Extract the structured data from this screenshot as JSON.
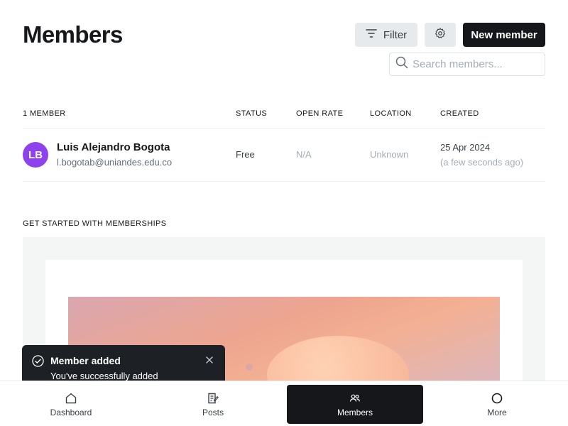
{
  "header": {
    "title": "Members",
    "filter_label": "Filter",
    "new_member_label": "New member"
  },
  "search": {
    "placeholder": "Search members..."
  },
  "table": {
    "columns": [
      "1 MEMBER",
      "STATUS",
      "OPEN RATE",
      "LOCATION",
      "CREATED"
    ],
    "rows": [
      {
        "initials": "LB",
        "name": "Luis Alejandro Bogota",
        "email": "l.bogotab@uniandes.edu.co",
        "status": "Free",
        "open_rate": "N/A",
        "location": "Unknown",
        "created_date": "25 Apr 2024",
        "created_relative": "(a few seconds ago)"
      }
    ]
  },
  "memberships": {
    "label": "GET STARTED WITH MEMBERSHIPS"
  },
  "toast": {
    "title": "Member added",
    "message": "You've successfully added"
  },
  "tabbar": {
    "items": [
      {
        "label": "Dashboard",
        "icon": "home-icon"
      },
      {
        "label": "Posts",
        "icon": "posts-icon"
      },
      {
        "label": "Members",
        "icon": "members-icon",
        "active": true
      },
      {
        "label": "More",
        "icon": "more-icon"
      }
    ]
  },
  "colors": {
    "primary": "#15171a",
    "avatar": "#8e42ee",
    "muted": "#a4adb5",
    "toast_bg": "#1d2125"
  }
}
